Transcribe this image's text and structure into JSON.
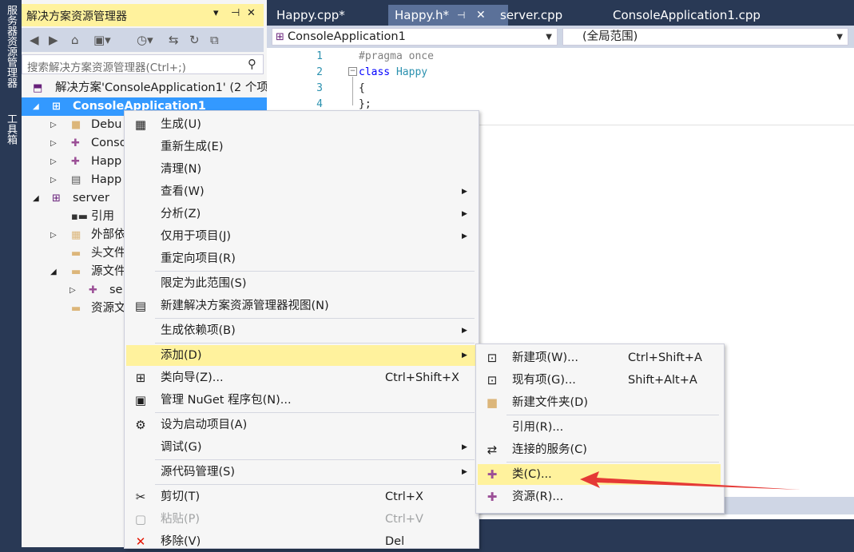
{
  "side_strip": {
    "server_explorer": "服务器资源管理器",
    "toolbox": "工具箱"
  },
  "solution_explorer": {
    "title": "解决方案资源管理器",
    "title_buttons": [
      "▾",
      "⊣",
      "✕"
    ],
    "search_placeholder": "搜索解决方案资源管理器(Ctrl+;)",
    "tree": [
      {
        "label": "解决方案'ConsoleApplication1' (2 个项",
        "icon": "solution-icon"
      },
      {
        "label": "ConsoleApplication1",
        "icon": "project-icon",
        "selected": true
      },
      {
        "label": "Debu",
        "icon": "folder-icon"
      },
      {
        "label": "Conso",
        "icon": "cpp-file-icon"
      },
      {
        "label": "Happ",
        "icon": "cpp-file-icon"
      },
      {
        "label": "Happ",
        "icon": "header-file-icon"
      },
      {
        "label": "server",
        "icon": "project-icon"
      },
      {
        "label": "引用",
        "icon": "references-icon"
      },
      {
        "label": "外部依",
        "icon": "external-deps-icon"
      },
      {
        "label": "头文件",
        "icon": "filter-folder-icon"
      },
      {
        "label": "源文件",
        "icon": "filter-folder-icon"
      },
      {
        "label": "se",
        "icon": "cpp-file-icon"
      },
      {
        "label": "资源文",
        "icon": "filter-folder-icon"
      }
    ]
  },
  "editor": {
    "tabs": [
      {
        "label": "Happy.cpp*"
      },
      {
        "label": "Happy.h*",
        "active": true
      },
      {
        "label": "server.cpp"
      },
      {
        "label": "ConsoleApplication1.cpp"
      }
    ],
    "scope_project": "ConsoleApplication1",
    "scope_global": "(全局范围)",
    "code_lines": [
      {
        "n": "1",
        "text": "#pragma once"
      },
      {
        "n": "2",
        "text": "class Happy"
      },
      {
        "n": "3",
        "text": "{"
      },
      {
        "n": "4",
        "text": "};"
      }
    ]
  },
  "context_menu": {
    "items": [
      {
        "label": "生成(U)",
        "icon": "build-icon"
      },
      {
        "label": "重新生成(E)"
      },
      {
        "label": "清理(N)"
      },
      {
        "label": "查看(W)",
        "submenu": true
      },
      {
        "label": "分析(Z)",
        "submenu": true
      },
      {
        "label": "仅用于项目(J)",
        "submenu": true
      },
      {
        "label": "重定向项目(R)"
      },
      {
        "label": "限定为此范围(S)"
      },
      {
        "label": "新建解决方案资源管理器视图(N)",
        "icon": "new-view-icon"
      },
      {
        "label": "生成依赖项(B)",
        "submenu": true
      },
      {
        "label": "添加(D)",
        "submenu": true,
        "highlighted": true
      },
      {
        "label": "类向导(Z)...",
        "shortcut": "Ctrl+Shift+X",
        "icon": "class-wizard-icon"
      },
      {
        "label": "管理 NuGet 程序包(N)...",
        "icon": "nuget-icon"
      },
      {
        "label": "设为启动项目(A)",
        "icon": "gear-icon"
      },
      {
        "label": "调试(G)",
        "submenu": true
      },
      {
        "label": "源代码管理(S)",
        "submenu": true
      },
      {
        "label": "剪切(T)",
        "shortcut": "Ctrl+X",
        "icon": "cut-icon"
      },
      {
        "label": "粘贴(P)",
        "shortcut": "Ctrl+V",
        "icon": "paste-icon",
        "disabled": true
      },
      {
        "label": "移除(V)",
        "shortcut": "Del",
        "icon": "remove-icon"
      }
    ]
  },
  "add_submenu": {
    "items": [
      {
        "label": "新建项(W)...",
        "shortcut": "Ctrl+Shift+A",
        "icon": "new-item-icon"
      },
      {
        "label": "现有项(G)...",
        "shortcut": "Shift+Alt+A",
        "icon": "existing-item-icon"
      },
      {
        "label": "新建文件夹(D)",
        "icon": "new-folder-icon"
      },
      {
        "label": "引用(R)..."
      },
      {
        "label": "连接的服务(C)",
        "icon": "connected-service-icon"
      },
      {
        "label": "类(C)...",
        "icon": "class-icon",
        "highlighted": true
      },
      {
        "label": "资源(R)...",
        "icon": "resource-icon"
      }
    ]
  },
  "colors": {
    "accent_yellow": "#fff29d",
    "selection_blue": "#3399ff",
    "frame": "#293955",
    "annotation_arrow": "#e53935"
  }
}
